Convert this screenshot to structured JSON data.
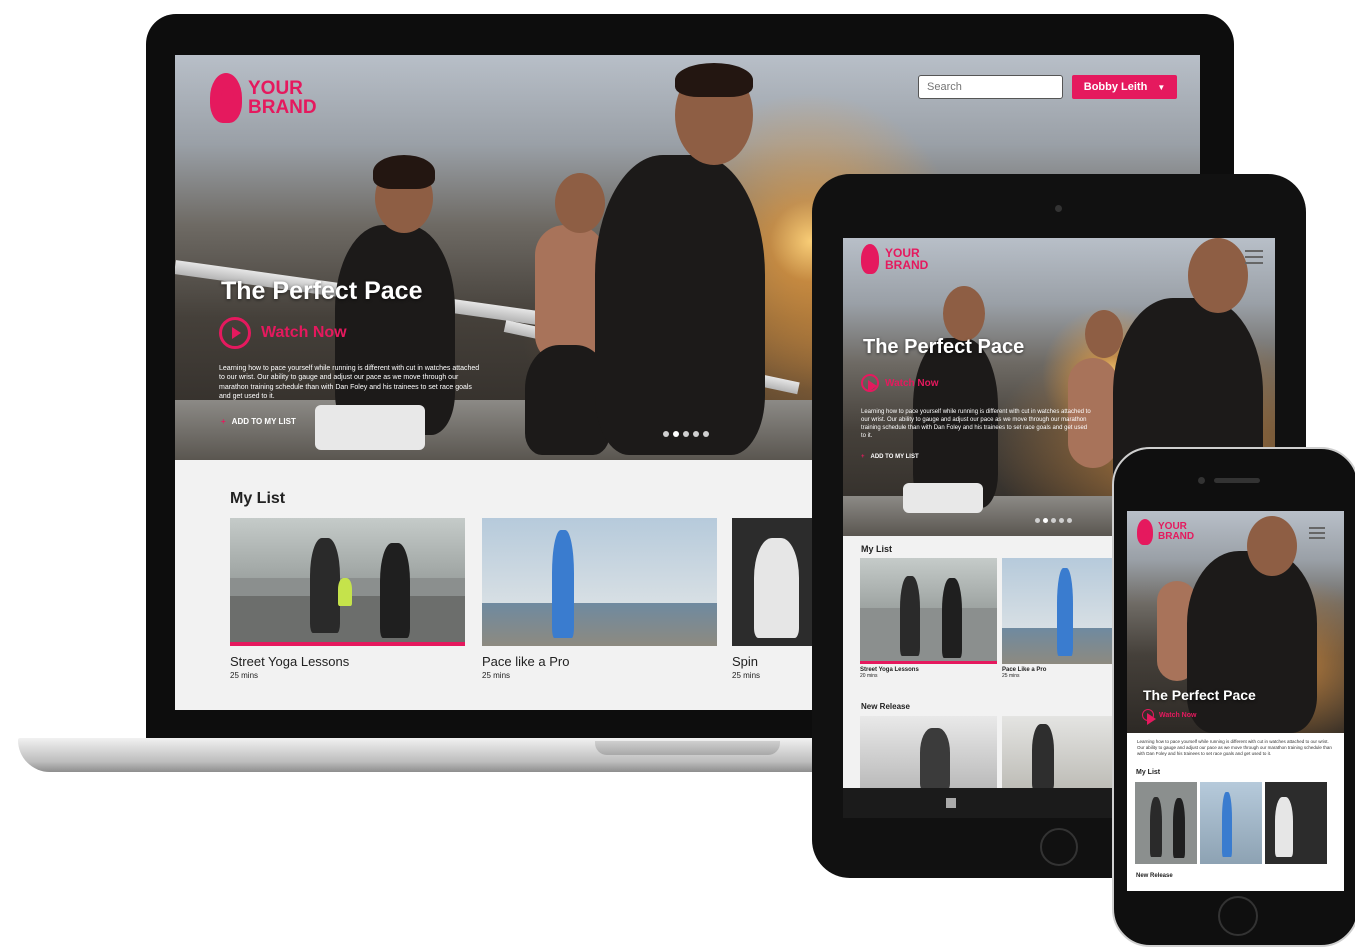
{
  "brand": {
    "line1": "YOUR",
    "line2": "BRAND",
    "color": "#e5195e"
  },
  "header": {
    "search_placeholder": "Search",
    "user_name": "Bobby Leith",
    "caret": "▼"
  },
  "hero": {
    "title": "The Perfect Pace",
    "watch_label": "Watch Now",
    "description": "Learning how to pace yourself while running is different with cut in watches attached to our wrist. Our ability to gauge and adjust our pace as we move through our marathon training schedule than with Dan Foley and his trainees to set race goals and get used to it.",
    "add_label": "ADD TO MY LIST",
    "slides": 5,
    "active_slide": 2
  },
  "my_list": {
    "title": "My List",
    "items": [
      {
        "title": "Street Yoga Lessons",
        "duration": "25 mins",
        "progress": 1.0
      },
      {
        "title": "Pace like a Pro",
        "duration": "25 mins"
      },
      {
        "title": "Spin",
        "duration": "25 mins"
      }
    ]
  },
  "tablet": {
    "my_list_title": "My List",
    "items": [
      {
        "title": "Street Yoga Lessons",
        "duration": "20 mins"
      },
      {
        "title": "Pace Like a Pro",
        "duration": "25 mins"
      }
    ],
    "new_release_title": "New Release"
  },
  "phone": {
    "my_list_title": "My List",
    "new_release_title": "New Release"
  }
}
